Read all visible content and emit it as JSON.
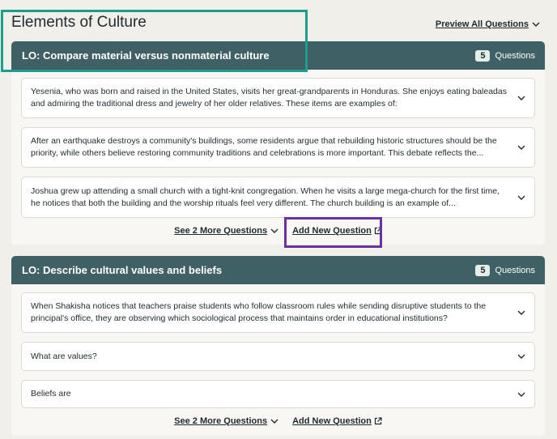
{
  "page": {
    "title": "Elements of Culture",
    "preview_all_label": "Preview All Questions"
  },
  "sections": [
    {
      "lo_title": "LO: Compare material versus nonmaterial culture",
      "question_count": "5",
      "questions_label": "Questions",
      "questions": [
        "Yesenia, who was born and raised in the United States, visits her great-grandparents in Honduras. She enjoys eating baleadas and admiring the traditional dress and jewelry of her older relatives. These items are examples of:",
        "After an earthquake destroys a community's buildings, some residents argue that rebuilding historic structures should be the priority, while others believe restoring community traditions and celebrations is more important. This debate reflects the...",
        "Joshua grew up attending a small church with a tight-knit congregation. When he visits a large mega-church for the first time, he notices that both the building and the worship rituals feel very different. The church building is an example of..."
      ],
      "see_more_label": "See 2 More Questions",
      "add_new_label": "Add New Question"
    },
    {
      "lo_title": "LO: Describe cultural values and beliefs",
      "question_count": "5",
      "questions_label": "Questions",
      "questions": [
        "When Shakisha notices that teachers praise students who follow classroom rules while sending disruptive students to the principal's office, they are observing which sociological process that maintains order in educational institutions?",
        "What are values?",
        "Beliefs are"
      ],
      "see_more_label": "See 2 More Questions",
      "add_new_label": "Add New Question"
    }
  ],
  "highlights": {
    "teal": "#1aa08a",
    "purple": "#6a32a0"
  },
  "colors": {
    "header_bg": "#3f6064",
    "page_bg": "#f1efea",
    "badge_bg": "#e4efe8"
  }
}
